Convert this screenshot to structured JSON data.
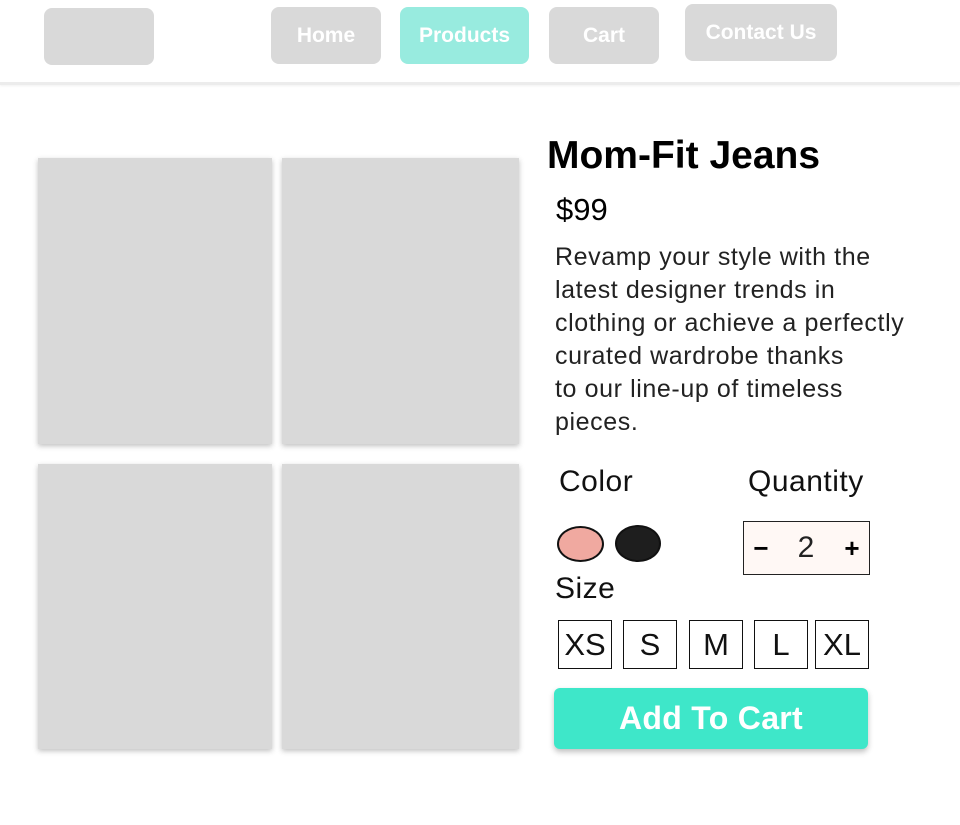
{
  "nav": {
    "items": [
      {
        "label": "Home",
        "active": false
      },
      {
        "label": "Products",
        "active": true
      },
      {
        "label": "Cart",
        "active": false
      },
      {
        "label": "Contact Us",
        "active": false
      }
    ]
  },
  "product": {
    "title": "Mom-Fit Jeans",
    "price": "$99",
    "description": "Revamp your style with the\nlatest designer trends in\nclothing or achieve a perfectly\ncurated wardrobe thanks\nto our line-up of timeless\npieces."
  },
  "color": {
    "label": "Color",
    "options": [
      {
        "name": "pink",
        "hex": "#f0a9a0"
      },
      {
        "name": "black",
        "hex": "#1e1e1e"
      }
    ]
  },
  "quantity": {
    "label": "Quantity",
    "minus": "−",
    "value": "2",
    "plus": "+"
  },
  "size": {
    "label": "Size",
    "options": [
      "XS",
      "S",
      "M",
      "L",
      "XL"
    ]
  },
  "cart_button": {
    "label": "Add To Cart"
  },
  "colors": {
    "accent": "#3ee7c9",
    "nav_active": "#98ebdf",
    "placeholder": "#d9d9d9"
  }
}
